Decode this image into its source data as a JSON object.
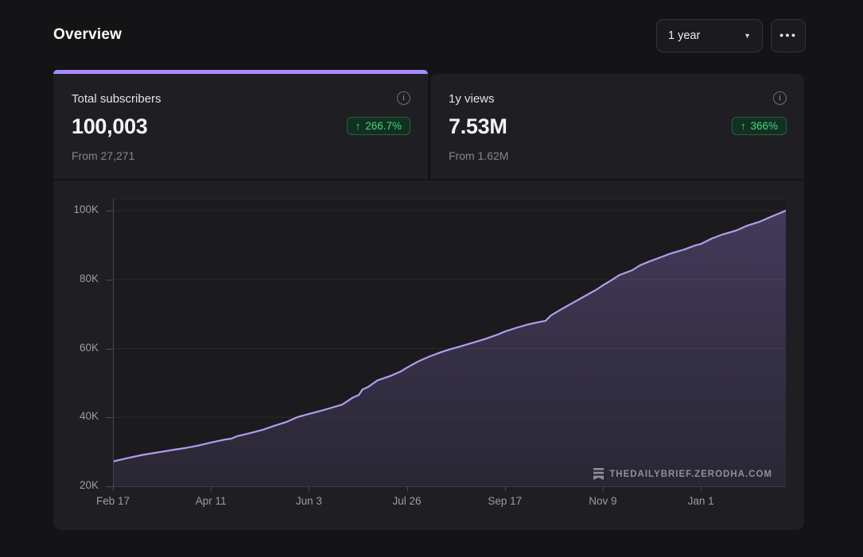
{
  "header": {
    "title": "Overview",
    "range_selector": {
      "value": "1 year"
    }
  },
  "icons": {
    "info": "i",
    "caret_down": "▼",
    "ellipsis": "●●●",
    "arrow_up": "↑"
  },
  "metrics": [
    {
      "label": "Total subscribers",
      "value": "100,003",
      "change": "266.7%",
      "change_direction": "up",
      "baseline": "From 27,271",
      "selected": true
    },
    {
      "label": "1y views",
      "value": "7.53M",
      "change": "366%",
      "change_direction": "up",
      "baseline": "From 1.62M",
      "selected": false
    }
  ],
  "watermark": {
    "text": "THEDAILYBRIEF.ZERODHA.COM",
    "icon": "substack-logo-icon"
  },
  "colors": {
    "accent_purple": "#a78bfa",
    "line_purple": "#b49bef",
    "area_top": "rgba(168,140,245,0.28)",
    "area_bottom": "rgba(168,140,245,0.10)",
    "badge_green_text": "#42d885",
    "card_bg": "#1f1f23",
    "page_bg": "#141417"
  },
  "chart_data": {
    "type": "area",
    "series_name": "Total subscribers",
    "unit": "thousands of subscribers",
    "x_unit": "days since Feb 17",
    "x_max": 364,
    "ylim": [
      20,
      100
    ],
    "y_gridlines": [
      40,
      60,
      80,
      100
    ],
    "y_ticks": [
      {
        "label": "20K",
        "value": 20
      },
      {
        "label": "40K",
        "value": 40
      },
      {
        "label": "60K",
        "value": 60
      },
      {
        "label": "80K",
        "value": 80
      },
      {
        "label": "100K",
        "value": 100
      }
    ],
    "x_ticks": [
      {
        "label": "Feb 17",
        "day": 0
      },
      {
        "label": "Apr 11",
        "day": 53
      },
      {
        "label": "Jun 3",
        "day": 106
      },
      {
        "label": "Jul 26",
        "day": 159
      },
      {
        "label": "Sep 17",
        "day": 212
      },
      {
        "label": "Nov 9",
        "day": 265
      },
      {
        "label": "Jan 1",
        "day": 318
      }
    ],
    "series": [
      {
        "name": "Total subscribers",
        "points": [
          [
            0,
            27.2
          ],
          [
            8,
            28.2
          ],
          [
            16,
            29.1
          ],
          [
            25,
            29.9
          ],
          [
            33,
            30.6
          ],
          [
            39,
            31.1
          ],
          [
            46,
            31.8
          ],
          [
            53,
            32.7
          ],
          [
            60,
            33.5
          ],
          [
            64,
            33.8
          ],
          [
            67,
            34.5
          ],
          [
            74,
            35.4
          ],
          [
            81,
            36.4
          ],
          [
            87,
            37.5
          ],
          [
            94,
            38.7
          ],
          [
            100,
            40.1
          ],
          [
            106,
            41.0
          ],
          [
            111,
            41.7
          ],
          [
            117,
            42.6
          ],
          [
            124,
            43.7
          ],
          [
            130,
            45.8
          ],
          [
            133,
            46.5
          ],
          [
            135,
            48.1
          ],
          [
            138,
            48.8
          ],
          [
            143,
            50.7
          ],
          [
            150,
            52.0
          ],
          [
            156,
            53.4
          ],
          [
            159,
            54.4
          ],
          [
            165,
            56.2
          ],
          [
            171,
            57.6
          ],
          [
            178,
            59.0
          ],
          [
            182,
            59.7
          ],
          [
            188,
            60.6
          ],
          [
            195,
            61.7
          ],
          [
            201,
            62.7
          ],
          [
            208,
            64.0
          ],
          [
            212,
            64.9
          ],
          [
            219,
            66.1
          ],
          [
            225,
            67.0
          ],
          [
            231,
            67.7
          ],
          [
            234,
            68.0
          ],
          [
            237,
            69.6
          ],
          [
            242,
            71.2
          ],
          [
            249,
            73.3
          ],
          [
            255,
            75.1
          ],
          [
            262,
            77.2
          ],
          [
            265,
            78.3
          ],
          [
            270,
            79.9
          ],
          [
            274,
            81.3
          ],
          [
            281,
            82.7
          ],
          [
            285,
            84.1
          ],
          [
            290,
            85.2
          ],
          [
            296,
            86.4
          ],
          [
            302,
            87.6
          ],
          [
            309,
            88.7
          ],
          [
            315,
            89.9
          ],
          [
            318,
            90.3
          ],
          [
            324,
            91.9
          ],
          [
            330,
            93.1
          ],
          [
            337,
            94.2
          ],
          [
            343,
            95.6
          ],
          [
            350,
            96.8
          ],
          [
            356,
            98.2
          ],
          [
            361,
            99.3
          ],
          [
            364,
            100.0
          ]
        ]
      }
    ]
  }
}
